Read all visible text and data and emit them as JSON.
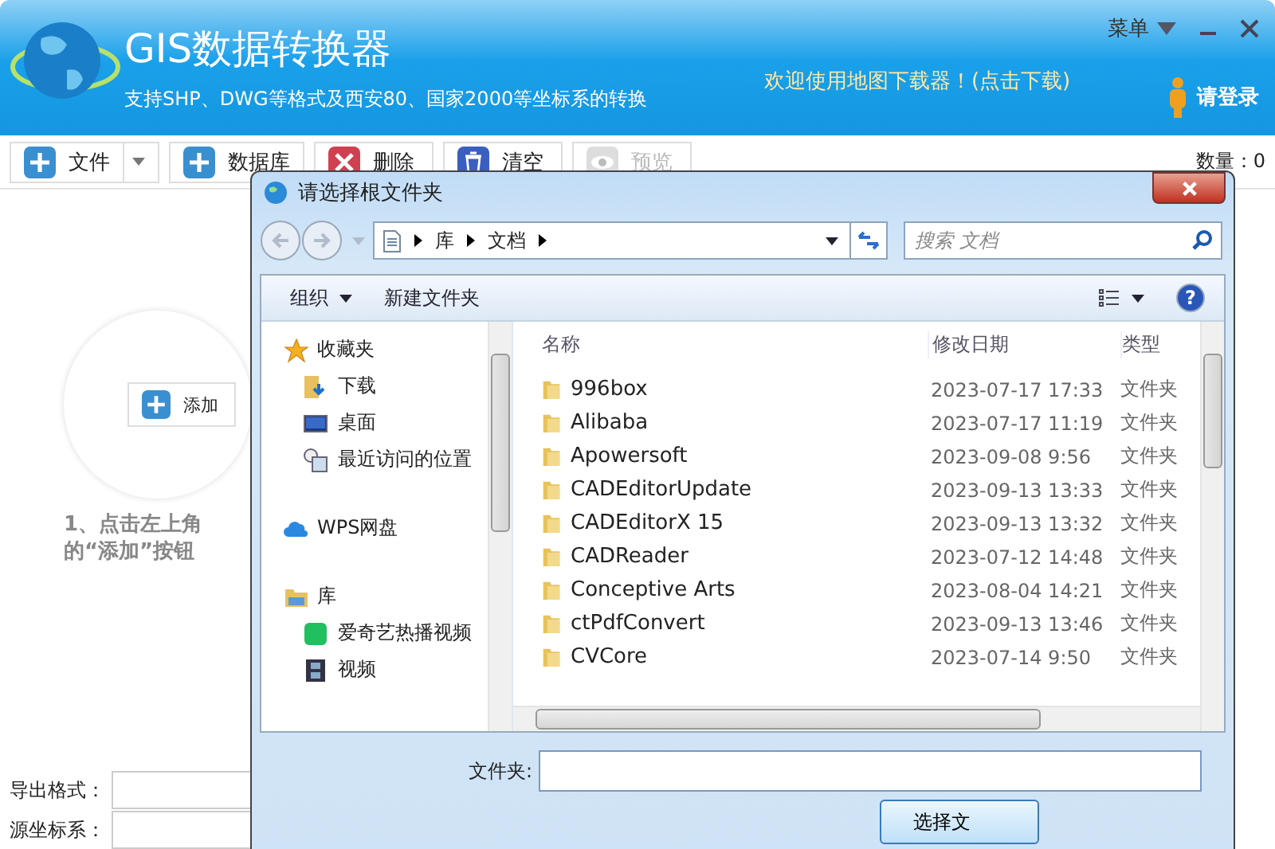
{
  "app": {
    "title": "GIS数据转换器",
    "subtitle": "支持SHP、DWG等格式及西安80、国家2000等坐标系的转换",
    "menu": "菜单",
    "promo": "欢迎使用地图下载器！(点击下载)",
    "login": "请登录"
  },
  "toolbar": [
    {
      "label": "文件",
      "kind": "add",
      "dropdown": true,
      "disabled": false
    },
    {
      "label": "数据库",
      "kind": "add",
      "dropdown": false,
      "disabled": false
    },
    {
      "label": "删除",
      "kind": "delete",
      "dropdown": false,
      "disabled": false
    },
    {
      "label": "清空",
      "kind": "clear",
      "dropdown": false,
      "disabled": false
    },
    {
      "label": "预览",
      "kind": "preview",
      "dropdown": false,
      "disabled": true
    }
  ],
  "count": "数量：0",
  "hint": {
    "button": "添加",
    "lines": [
      "1、点击左上角",
      "的“添加”按钮"
    ]
  },
  "form": [
    {
      "label": "导出格式："
    },
    {
      "label": "源坐标系："
    }
  ],
  "dialog": {
    "title": "请选择根文件夹",
    "breadcrumb": [
      "库",
      "文档"
    ],
    "search": {
      "placeholder": "搜索 文档"
    },
    "commands": [
      {
        "label": "组织",
        "dropdown": true
      },
      {
        "label": "新建文件夹",
        "dropdown": false
      }
    ],
    "nav": [
      {
        "label": "收藏夹",
        "kind": "star",
        "children": [
          {
            "label": "下载",
            "kind": "download"
          },
          {
            "label": "桌面",
            "kind": "desktop"
          },
          {
            "label": "最近访问的位置",
            "kind": "recent"
          }
        ]
      },
      {
        "label": "WPS网盘",
        "kind": "cloud"
      },
      {
        "label": "库",
        "kind": "library",
        "children": [
          {
            "label": "爱奇艺热播视频",
            "kind": "iqiyi"
          },
          {
            "label": "视频",
            "kind": "video"
          }
        ]
      }
    ],
    "columns": [
      "名称",
      "修改日期",
      "类型"
    ],
    "rows": [
      {
        "name": "996box",
        "modified": "2023-07-17 17:33",
        "type": "文件夹"
      },
      {
        "name": "Alibaba",
        "modified": "2023-07-17 11:19",
        "type": "文件夹"
      },
      {
        "name": "Apowersoft",
        "modified": "2023-09-08 9:56",
        "type": "文件夹"
      },
      {
        "name": "CADEditorUpdate",
        "modified": "2023-09-13 13:33",
        "type": "文件夹"
      },
      {
        "name": "CADEditorX 15",
        "modified": "2023-09-13 13:32",
        "type": "文件夹"
      },
      {
        "name": "CADReader",
        "modified": "2023-07-12 14:48",
        "type": "文件夹"
      },
      {
        "name": "Conceptive Arts",
        "modified": "2023-08-04 14:21",
        "type": "文件夹"
      },
      {
        "name": "ctPdfConvert",
        "modified": "2023-09-13 13:46",
        "type": "文件夹"
      },
      {
        "name": "CVCore",
        "modified": "2023-07-14 9:50",
        "type": "文件夹"
      }
    ],
    "help": "?",
    "folder_label": "文件夹:",
    "ok_button": "选择文"
  }
}
